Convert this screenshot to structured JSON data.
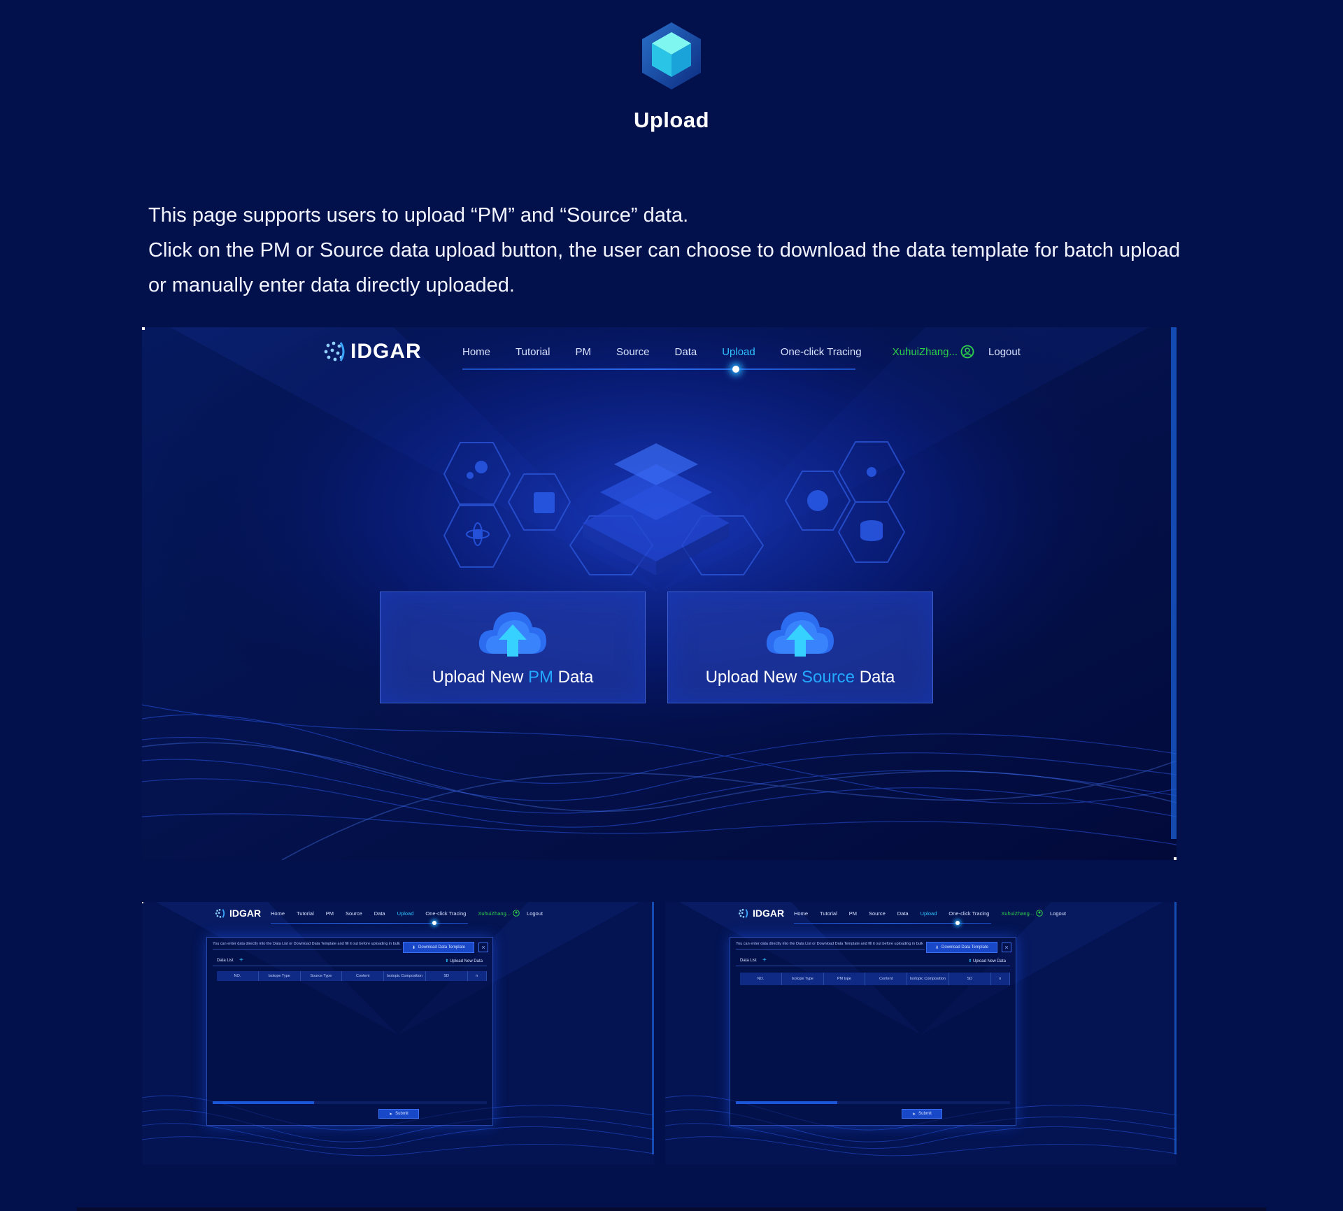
{
  "heading": "Upload",
  "intro": {
    "line1": "This page supports users to upload “PM” and “Source” data.",
    "line2": "Click on the PM or Source data upload button, the user can choose to download the data template for batch upload or manually enter data directly uploaded."
  },
  "app": {
    "logo": "IDGAR",
    "nav": [
      "Home",
      "Tutorial",
      "PM",
      "Source",
      "Data",
      "Upload",
      "One-click Tracing"
    ],
    "active_nav": "Upload",
    "user": "XuhuiZhang...",
    "logout": "Logout"
  },
  "upload_cards": {
    "pm": {
      "prefix": "Upload New ",
      "highlight": "PM",
      "suffix": " Data"
    },
    "source": {
      "prefix": "Upload New ",
      "highlight": "Source",
      "suffix": " Data"
    }
  },
  "pm_form": {
    "hint": "You can enter data directly into the Data List or Download Data Template and fill it out before uploading in bulk",
    "download_btn": "Download Data Template",
    "close": "×",
    "tab": "Data List",
    "add": "+",
    "upload_new": "Upload New Data",
    "columns": [
      "NO.",
      "Isotope Type",
      "Source Type",
      "Content",
      "Isotopic Composition",
      "SD",
      "n"
    ],
    "submit": "Submit",
    "scroll_fraction": 0.37
  },
  "source_form": {
    "hint": "You can enter data directly into the Data List or Download Data Template and fill it out before uploading in bulk",
    "download_btn": "Download Data Template",
    "close": "×",
    "tab": "Data List",
    "add": "+",
    "upload_new": "Upload New Data",
    "columns": [
      "NO.",
      "Isotope Type",
      "PM type",
      "Content",
      "Isotopic Composition",
      "SD",
      "n"
    ],
    "submit": "Submit",
    "scroll_fraction": 0.37
  },
  "colors": {
    "page_bg": "#02104c",
    "accent": "#23a9ff",
    "user_green": "#2ed14a",
    "card_bg": "#2a3fb0"
  },
  "icons": [
    "cube-icon",
    "idgar-logo-icon",
    "user-icon",
    "cloud-upload-icon",
    "download-icon",
    "upload-icon",
    "send-icon"
  ]
}
